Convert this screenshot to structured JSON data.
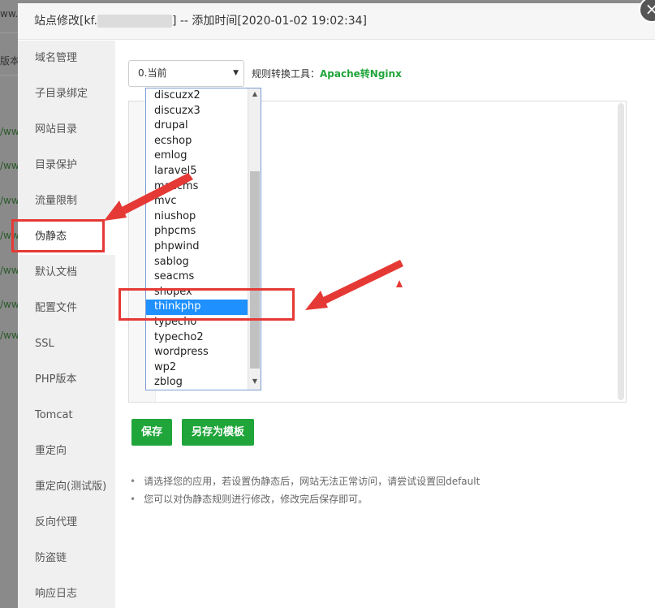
{
  "background": {
    "rows": [
      "ww.l",
      "版本",
      "/ww",
      "/ww",
      "/ww",
      "/ww",
      "/ww",
      "/ww",
      "/ww"
    ]
  },
  "modal": {
    "title_prefix": "站点修改[kf.",
    "title_suffix": "] -- 添加时间[2020-01-02 19:02:34]",
    "close_icon": "×"
  },
  "side_menu": {
    "items": [
      {
        "label": "域名管理"
      },
      {
        "label": "子目录绑定"
      },
      {
        "label": "网站目录"
      },
      {
        "label": "目录保护"
      },
      {
        "label": "流量限制"
      },
      {
        "label": "伪静态"
      },
      {
        "label": "默认文档"
      },
      {
        "label": "配置文件"
      },
      {
        "label": "SSL"
      },
      {
        "label": "PHP版本"
      },
      {
        "label": "Tomcat"
      },
      {
        "label": "重定向"
      },
      {
        "label": "重定向(测试版)"
      },
      {
        "label": "反向代理"
      },
      {
        "label": "防盗链"
      },
      {
        "label": "响应日志"
      }
    ],
    "active_index": 5
  },
  "rewrite": {
    "select_value": "0.当前",
    "tool_label": "规则转换工具：",
    "tool_link": "Apache转Nginx",
    "dropdown_options": [
      "discuzx2",
      "discuzx3",
      "drupal",
      "ecshop",
      "emlog",
      "laravel5",
      "maccms",
      "mvc",
      "niushop",
      "phpcms",
      "phpwind",
      "sablog",
      "seacms",
      "shopex",
      "thinkphp",
      "typecho",
      "typecho2",
      "wordpress",
      "wp2",
      "zblog"
    ],
    "selected_option": "thinkphp",
    "save_label": "保存",
    "save_template_label": "另存为模板",
    "tips": [
      "请选择您的应用，若设置伪静态后，网站无法正常访问，请尝试设置回default",
      "您可以对伪静态规则进行修改，修改完后保存即可。"
    ]
  },
  "colors": {
    "accent_green": "#20a53a",
    "highlight_red": "#e53935",
    "selection_blue": "#1e90ff"
  }
}
